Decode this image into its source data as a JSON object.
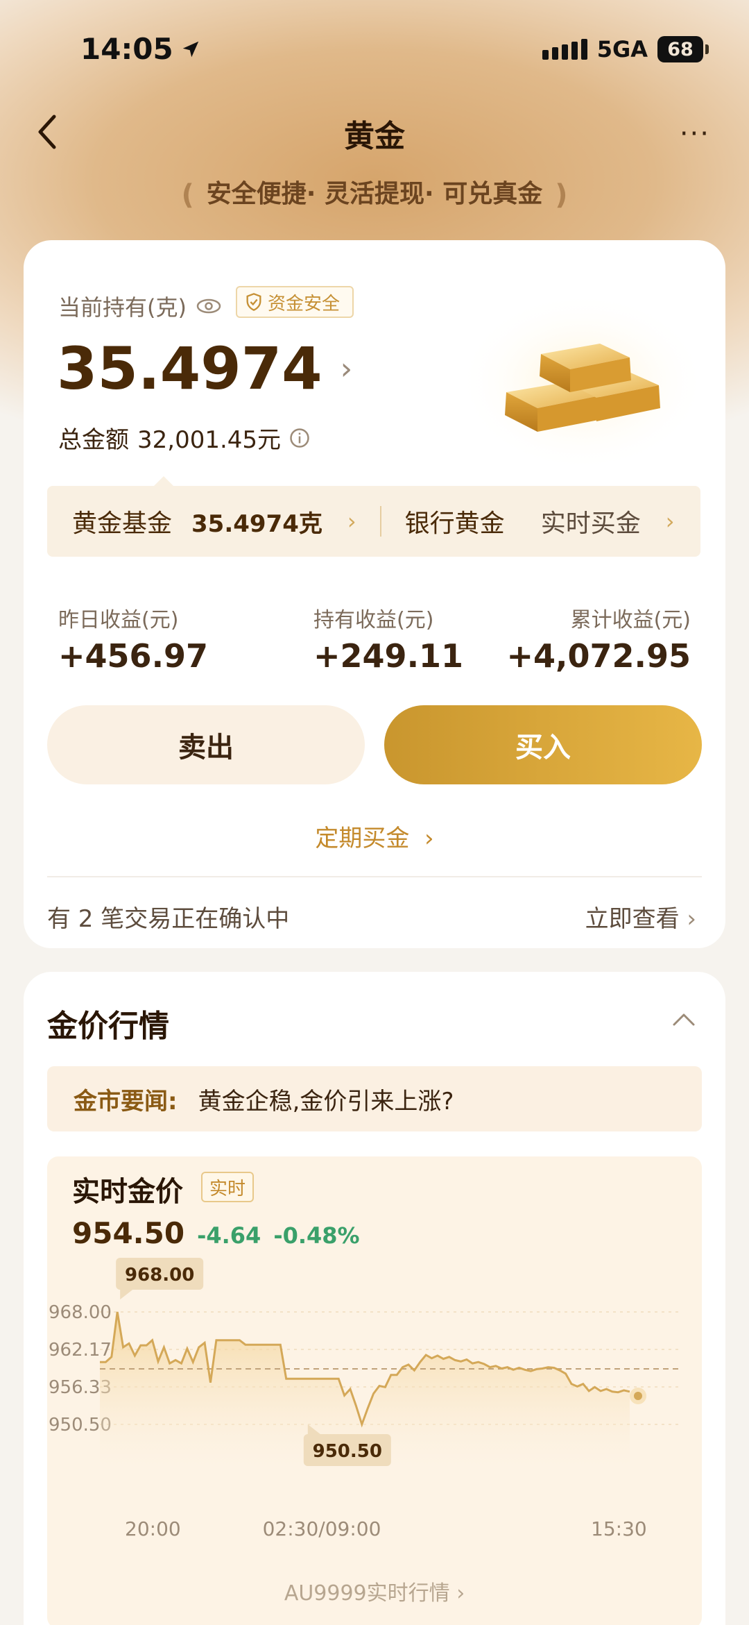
{
  "status_bar": {
    "time": "14:05",
    "network": "5GA",
    "battery": "68"
  },
  "nav": {
    "title": "黄金",
    "more": "···"
  },
  "slogan": "安全便捷· 灵活提现· 可兑真金",
  "holding": {
    "label": "当前持有(克)",
    "safe_badge": "资金安全",
    "amount": "35.4974",
    "total_label": "总金额",
    "total_value": "32,001.45元"
  },
  "fund_strip": {
    "fund_label": "黄金基金",
    "fund_value": "35.4974克",
    "bank_label": "银行黄金",
    "realtime_buy": "实时买金"
  },
  "stats": [
    {
      "label": "昨日收益(元)",
      "value": "+456.97"
    },
    {
      "label": "持有收益(元)",
      "value": "+249.11"
    },
    {
      "label": "累计收益(元)",
      "value": "+4,072.95"
    }
  ],
  "buttons": {
    "sell": "卖出",
    "buy": "买入",
    "scheduled": "定期买金"
  },
  "pending": {
    "text": "有 2 笔交易正在确认中",
    "link": "立即查看"
  },
  "market": {
    "title": "金价行情",
    "news_label": "金市要闻:",
    "news_text": "黄金企稳,金价引来上涨?",
    "realtime_title": "实时金价",
    "realtime_badge": "实时",
    "price": "954.50",
    "change": "-4.64",
    "change_pct": "-0.48%",
    "link": "AU9999实时行情"
  },
  "colors": {
    "gold": "#c9962e",
    "up_down_green": "#3aa06a",
    "text_brown": "#4a2a08"
  },
  "chart_data": {
    "type": "area",
    "y_ticks": [
      "968.00",
      "962.17",
      "956.33",
      "950.50"
    ],
    "x_ticks": [
      "20:00",
      "02:30/09:00",
      "15:30"
    ],
    "ylim": [
      950.5,
      968.0
    ],
    "reference_line": 959.14,
    "max_label": "968.00",
    "min_label": "950.50",
    "x": [
      0,
      1,
      2,
      3,
      4,
      5,
      6,
      7,
      8,
      9,
      10,
      11,
      12,
      13,
      14,
      15,
      16,
      17,
      18,
      19,
      20,
      21,
      22,
      23,
      24,
      25,
      26,
      27,
      28,
      29,
      30,
      31,
      32,
      33,
      34,
      35,
      36,
      37,
      38,
      39,
      40,
      41,
      42,
      43,
      44,
      45,
      46,
      47,
      48,
      49,
      50,
      51,
      52,
      53,
      54,
      55,
      56,
      57,
      58,
      59,
      60,
      61,
      62,
      63,
      64,
      65,
      66,
      67,
      68,
      69,
      70,
      71,
      72,
      73,
      74,
      75,
      76,
      77,
      78,
      79,
      80,
      81,
      82,
      83,
      84,
      85,
      86,
      87,
      88,
      89,
      90,
      91
    ],
    "values": [
      960.2,
      960.2,
      961.0,
      968.0,
      962.5,
      963.1,
      961.2,
      962.8,
      962.8,
      963.6,
      960.3,
      962.5,
      960.0,
      960.5,
      960.0,
      962.3,
      960.2,
      962.5,
      963.2,
      957.0,
      963.6,
      963.6,
      963.6,
      963.6,
      963.6,
      962.9,
      962.9,
      962.9,
      962.9,
      962.9,
      962.9,
      962.9,
      957.6,
      957.6,
      957.6,
      957.6,
      957.6,
      957.6,
      957.6,
      957.6,
      957.6,
      957.6,
      955.0,
      956.0,
      953.4,
      950.5,
      953.0,
      955.3,
      956.5,
      956.3,
      958.2,
      958.2,
      959.4,
      959.8,
      958.9,
      960.2,
      961.3,
      960.8,
      961.2,
      960.7,
      961.0,
      960.5,
      960.3,
      960.6,
      960.0,
      960.2,
      959.9,
      959.4,
      959.6,
      959.2,
      959.4,
      959.0,
      959.3,
      959.0,
      958.8,
      959.1,
      959.2,
      959.4,
      959.3,
      958.9,
      958.4,
      956.8,
      956.4,
      956.8,
      955.7,
      956.3,
      955.7,
      956.0,
      955.6,
      955.5,
      955.8,
      955.6
    ],
    "current": 954.5
  }
}
